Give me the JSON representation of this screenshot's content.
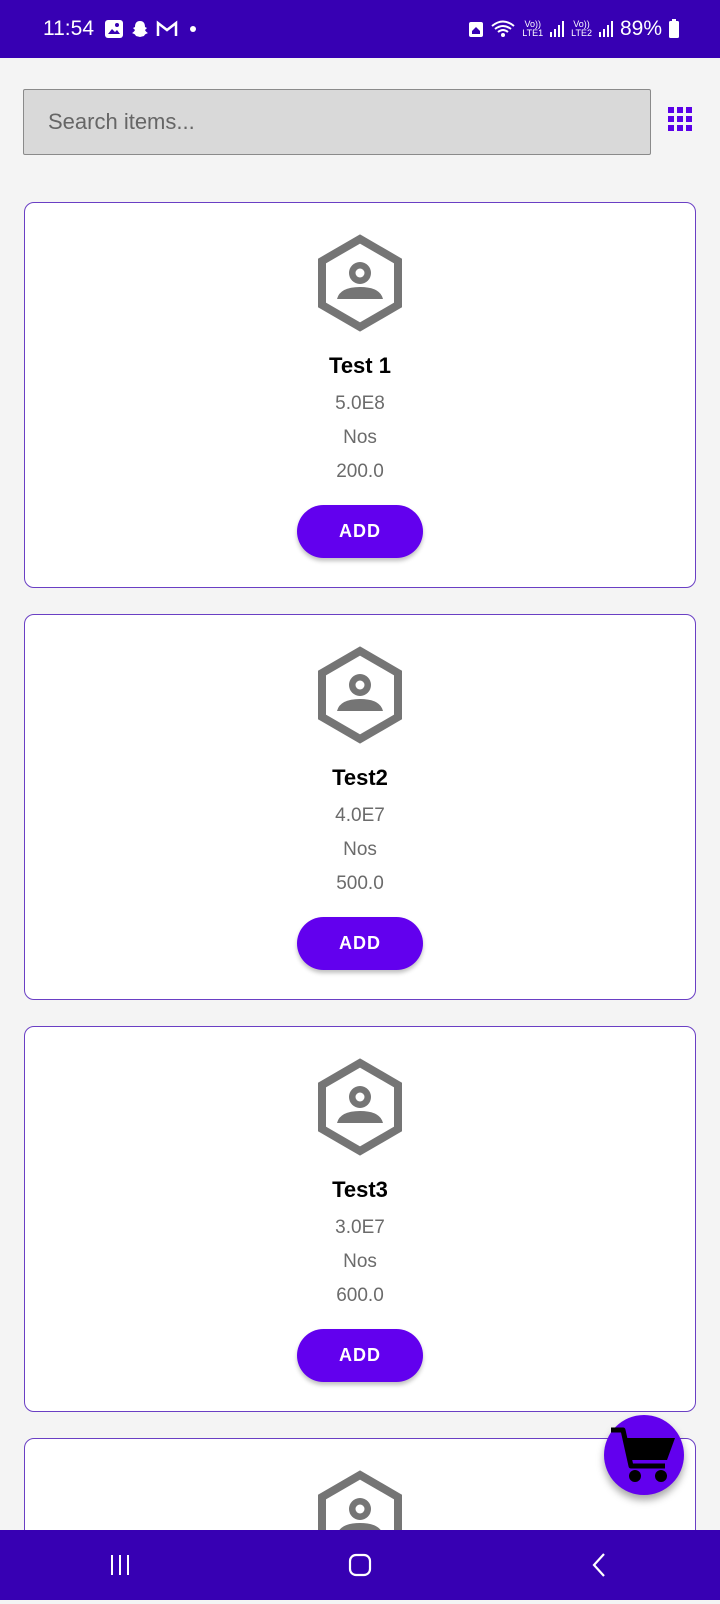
{
  "status_bar": {
    "time": "11:54",
    "battery": "89%",
    "sim1_label": "LTE1",
    "sim2_label": "LTE2",
    "volte": "Vo))"
  },
  "search": {
    "placeholder": "Search items...",
    "value": ""
  },
  "items": [
    {
      "name": "Test 1",
      "code": "5.0E8",
      "unit": "Nos",
      "price": "200.0",
      "button": "ADD"
    },
    {
      "name": "Test2",
      "code": "4.0E7",
      "unit": "Nos",
      "price": "500.0",
      "button": "ADD"
    },
    {
      "name": "Test3",
      "code": "3.0E7",
      "unit": "Nos",
      "price": "600.0",
      "button": "ADD"
    }
  ],
  "icons": {
    "grid_toggle": "grid-view-icon",
    "item_image": "hexagon-person-placeholder-icon",
    "cart": "shopping-cart-icon"
  },
  "colors": {
    "status_bar": "#3700b3",
    "nav_bar": "#3700b3",
    "accent": "#6200ee",
    "card_border": "#6a3fc4",
    "placeholder_gray": "#757575"
  }
}
